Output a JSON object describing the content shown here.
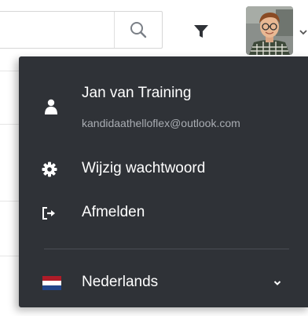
{
  "search": {
    "value": "",
    "placeholder": ""
  },
  "icons": {
    "search": "search-icon",
    "filter": "filter-icon",
    "avatar_caret": "chevron-down-icon",
    "user": "user-icon",
    "settings": "gear-icon",
    "logout": "sign-out-icon",
    "language_chevron": "chevron-down-icon"
  },
  "user_menu": {
    "name": "Jan van Training",
    "email": "kandidaathelloflex@outlook.com",
    "items": [
      {
        "label": "Wijzig wachtwoord",
        "icon": "gear-icon"
      },
      {
        "label": "Afmelden",
        "icon": "sign-out-icon"
      }
    ],
    "language": {
      "label": "Nederlands",
      "flag": "netherlands-flag"
    }
  },
  "colors": {
    "menu_background": "#2f3237",
    "menu_text": "#ffffff",
    "menu_secondary_text": "#a9adb3",
    "flag_red": "#ae1c28",
    "flag_white": "#ffffff",
    "flag_blue": "#21468b"
  }
}
